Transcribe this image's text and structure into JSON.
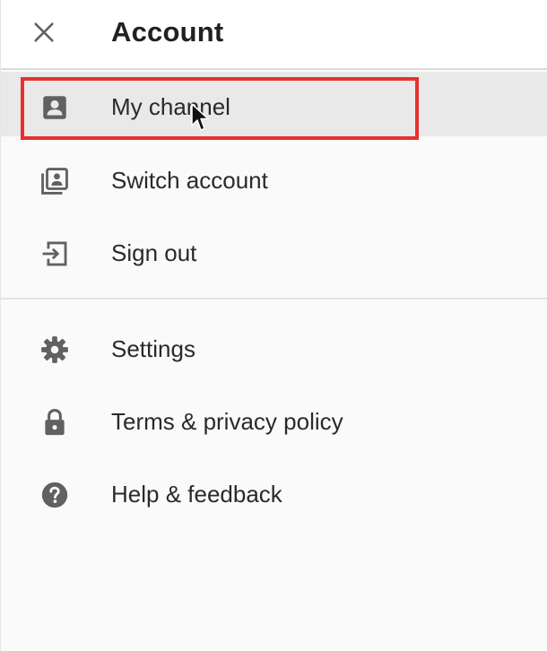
{
  "header": {
    "title": "Account",
    "close_icon": "close-icon"
  },
  "account_section": {
    "items": [
      {
        "label": "My channel",
        "icon": "account-box-icon",
        "selected": true,
        "highlighted": true
      },
      {
        "label": "Switch account",
        "icon": "switch-account-icon"
      },
      {
        "label": "Sign out",
        "icon": "sign-out-icon"
      }
    ]
  },
  "settings_section": {
    "items": [
      {
        "label": "Settings",
        "icon": "gear-icon"
      },
      {
        "label": "Terms & privacy policy",
        "icon": "lock-icon"
      },
      {
        "label": "Help & feedback",
        "icon": "help-icon"
      }
    ]
  },
  "colors": {
    "icon": "#616161",
    "highlight_border": "#e8312f",
    "selected_background": "#e9e9e9",
    "divider": "#e3e3e3"
  }
}
